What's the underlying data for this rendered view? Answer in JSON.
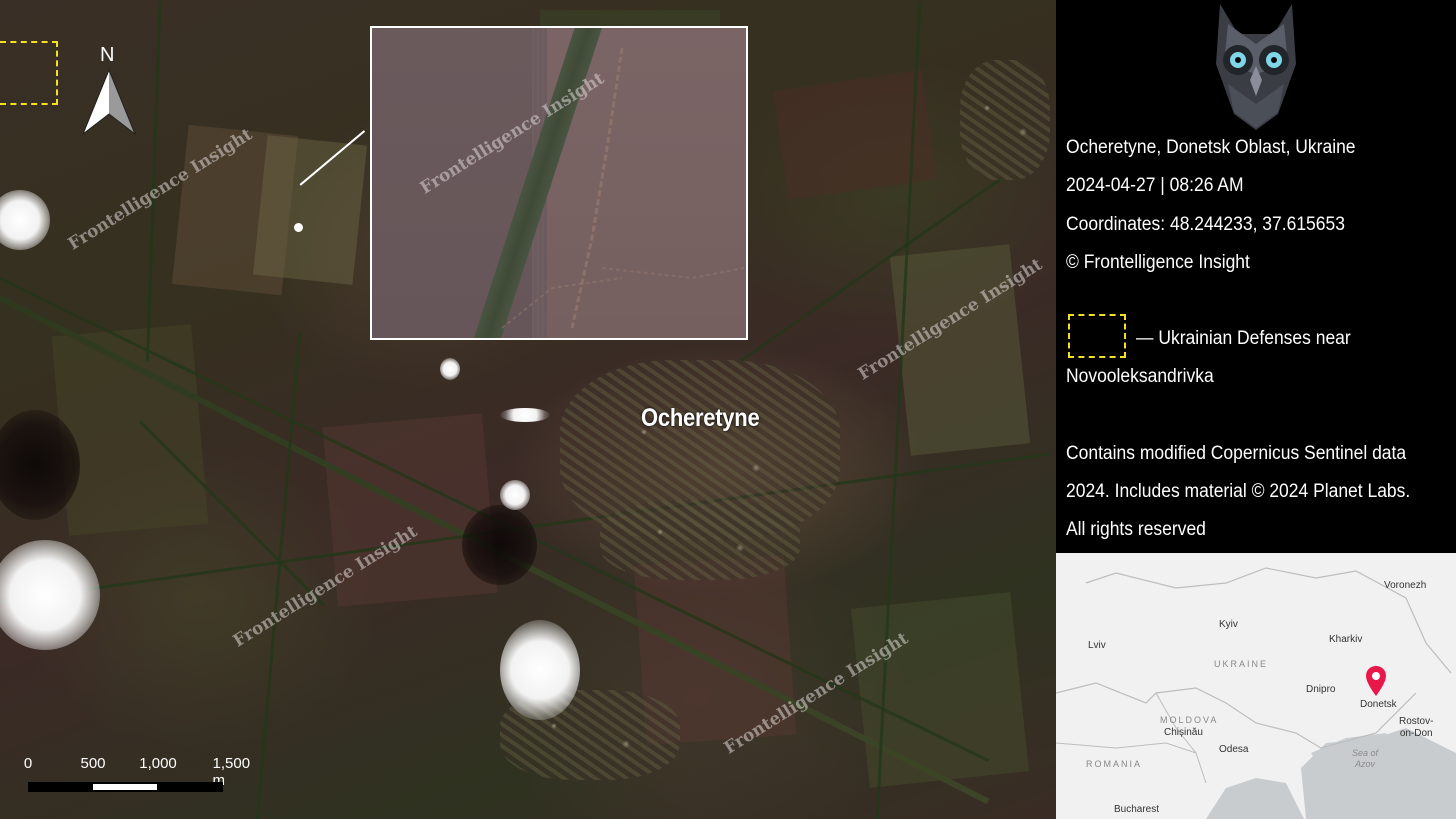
{
  "map": {
    "city_label": "Ocheretyne",
    "north_label": "N",
    "watermark_text": "Frontelligence Insight",
    "scale_labels": [
      "0",
      "500",
      "1,000",
      "1,500 m"
    ],
    "colors": {
      "defense_box": "#f5e11e",
      "inset_border": "#ffffff"
    }
  },
  "panel": {
    "logo": "owl-icon",
    "location": "Ocheretyne, Donetsk Oblast, Ukraine",
    "datetime": "2024-04-27 | 08:26 AM",
    "coordinates": "Coordinates: 48.244233, 37.615653",
    "copyright": "© Frontelligence Insight",
    "legend_line1": "— Ukrainian Defenses near",
    "legend_line2": "Novooleksandrivka",
    "credit_line1": "Contains modified Copernicus Sentinel data",
    "credit_line2": "2024. Includes material © 2024 Planet Labs.",
    "credit_line3": "All rights reserved"
  },
  "locator": {
    "cities": {
      "voronezh": "Voronezh",
      "kyiv": "Kyiv",
      "kharkiv": "Kharkiv",
      "lviv": "Lviv",
      "dnipro": "Dnipro",
      "donetsk": "Donetsk",
      "chisinau": "Chișinău",
      "rostov": "Rostov-\non-Don",
      "odesa": "Odesa",
      "bucharest": "Bucharest",
      "sea_of_azov": "Sea of\nAzov"
    },
    "countries": {
      "ukraine": "UKRAINE",
      "moldova": "MOLDOVA",
      "romania": "ROMANIA"
    },
    "marker_color": "#e8194a",
    "marker_icon": "map-pin-icon"
  }
}
